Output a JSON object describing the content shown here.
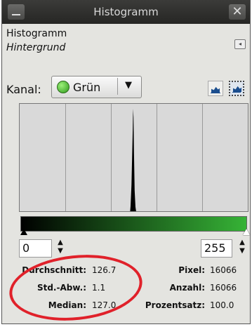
{
  "window": {
    "title": "Histogramm",
    "minimize_icon": "minimize-icon",
    "close_symbol": "✕"
  },
  "panel": {
    "title": "Histogramm",
    "layer": "Hintergrund",
    "channel_label": "Kanal:",
    "channel_value": "Grün",
    "channel_icon": "green-channel-icon",
    "dropdown_arrow": "▼",
    "dock_menu_symbol": "◂"
  },
  "histogram": {
    "type": "histogram",
    "x_range": [
      0,
      255
    ],
    "channel_color": "#36b336",
    "peak_center": 127,
    "grid_columns": 5
  },
  "range": {
    "start": "0",
    "end": "255",
    "spin_up": "▲",
    "spin_down": "▼"
  },
  "stats": {
    "mean_label": "Durchschnitt:",
    "mean_value": "126.7",
    "stddev_label": "Std.-Abw.:",
    "stddev_value": "1.1",
    "median_label": "Median:",
    "median_value": "127.0",
    "pixels_label": "Pixel:",
    "pixels_value": "16066",
    "count_label": "Anzahl:",
    "count_value": "16066",
    "percentile_label": "Prozentsatz:",
    "percentile_value": "100.0"
  },
  "annotation_color": "#e0212a"
}
